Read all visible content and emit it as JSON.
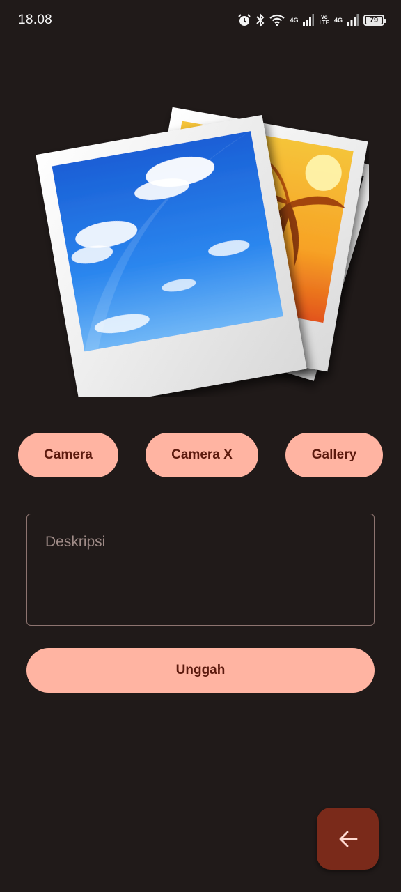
{
  "status_bar": {
    "time": "18.08",
    "net1": "4G",
    "volte_top": "Vo",
    "volte_bottom": "LTE",
    "net2": "4G",
    "battery": "79",
    "icons": [
      "alarm-icon",
      "bluetooth-icon",
      "wifi-icon",
      "signal-icon",
      "signal-icon",
      "battery-icon"
    ]
  },
  "illustration": {
    "icon": "photo-stack-icon"
  },
  "actions": {
    "camera_label": "Camera",
    "camerax_label": "Camera X",
    "gallery_label": "Gallery"
  },
  "description": {
    "placeholder": "Deskripsi",
    "value": ""
  },
  "upload_label": "Unggah",
  "fab": {
    "icon": "arrow-back-icon"
  },
  "colors": {
    "background": "#201a19",
    "button": "#ffb4a2",
    "button_text": "#5c1a0e",
    "fab": "#7a2a1a",
    "outline": "#8d7470"
  }
}
